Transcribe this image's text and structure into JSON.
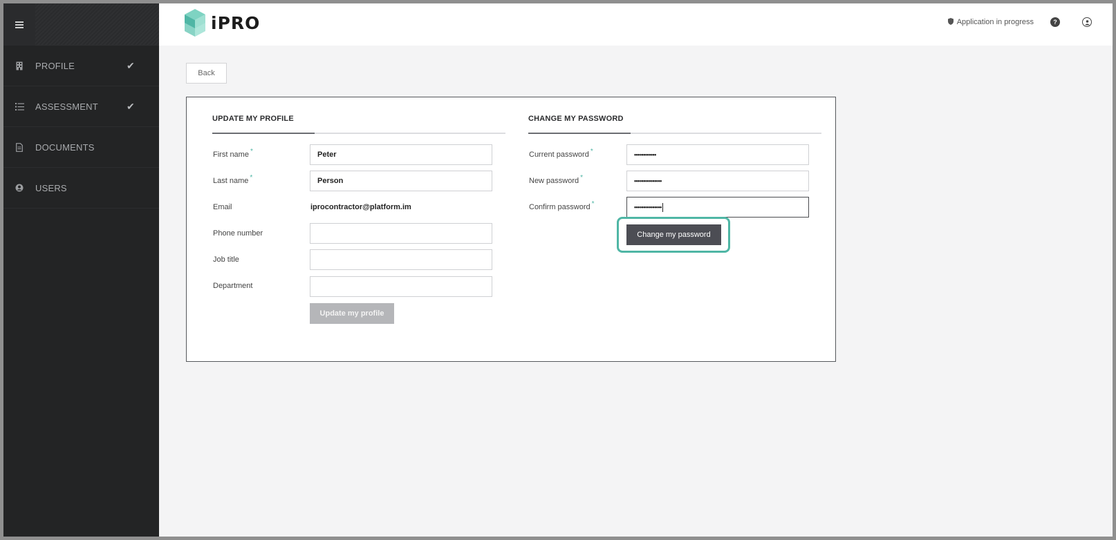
{
  "app": {
    "logo_text": "iPRO",
    "status_text": "Application in progress",
    "status_icon": "shield-icon",
    "help_icon": "help-icon",
    "user_icon": "user-circle-icon",
    "accent_color": "#4fb6a5"
  },
  "sidebar": {
    "menu_icon": "hamburger-icon",
    "items": [
      {
        "label": "PROFILE",
        "icon": "building-icon",
        "checked": true
      },
      {
        "label": "ASSESSMENT",
        "icon": "list-icon",
        "checked": true
      },
      {
        "label": "DOCUMENTS",
        "icon": "document-icon",
        "checked": false
      },
      {
        "label": "USERS",
        "icon": "user-icon",
        "checked": false
      }
    ]
  },
  "main": {
    "back_label": "Back",
    "profile": {
      "title": "UPDATE MY PROFILE",
      "first_name_label": "First name",
      "first_name_value": "Peter",
      "last_name_label": "Last name",
      "last_name_value": "Person",
      "email_label": "Email",
      "email_value": "iprocontractor@platform.im",
      "phone_label": "Phone number",
      "phone_value": "",
      "job_title_label": "Job title",
      "job_title_value": "",
      "department_label": "Department",
      "department_value": "",
      "submit_label": "Update my profile"
    },
    "password": {
      "title": "CHANGE MY PASSWORD",
      "current_label": "Current password",
      "current_value": "••••••••••••",
      "new_label": "New password",
      "new_value": "•••••••••••••••",
      "confirm_label": "Confirm password",
      "confirm_value": "•••••••••••••••",
      "submit_label": "Change my password"
    },
    "required_marker": "*"
  }
}
